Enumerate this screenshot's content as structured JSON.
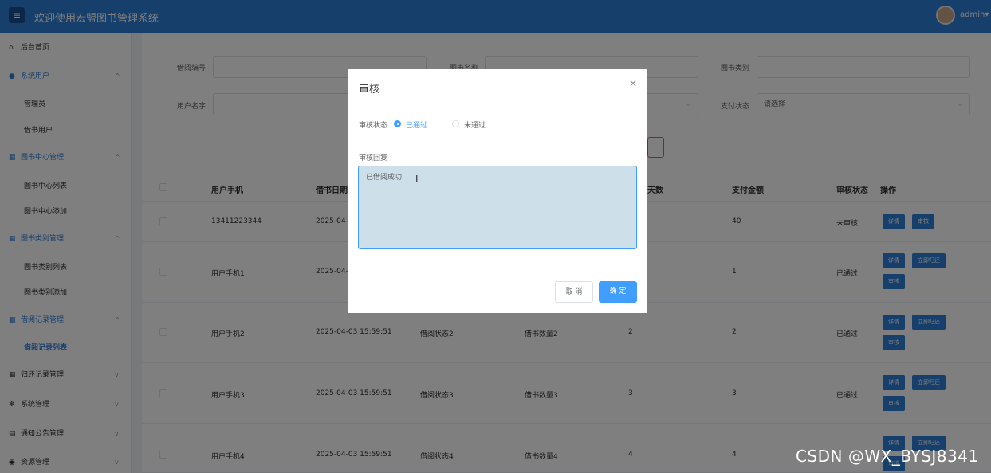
{
  "header": {
    "title": "欢迎使用宏盟图书管理系统",
    "user": "admin"
  },
  "sidebar": {
    "home": "后台首页",
    "system_users": "系统用户",
    "admin": "管理员",
    "borrow_users": "借书用户",
    "library_center_mgmt": "图书中心管理",
    "library_center_list": "图书中心列表",
    "library_center_add": "图书中心添加",
    "category_mgmt": "图书类别管理",
    "category_list": "图书类别列表",
    "category_add": "图书类别添加",
    "borrow_mgmt": "借阅记录管理",
    "borrow_list": "借阅记录列表",
    "return_mgmt": "归还记录管理",
    "system_mgmt": "系统管理",
    "notice_mgmt": "通知公告管理",
    "resource_mgmt": "资源管理"
  },
  "filters": {
    "borrow_no": "借阅编号",
    "book_name": "图书名称",
    "book_category": "图书类别",
    "user_name": "用户名字",
    "pay_status": "支付状态",
    "pay_placeholder": "请选择"
  },
  "table": {
    "headers": {
      "phone": "用户手机",
      "borrow_date": "借书日期",
      "days": "天数",
      "amount": "支付金额",
      "audit": "审核状态",
      "ops": "操作"
    },
    "rows": [
      {
        "phone": "13411223344",
        "date": "2025-04-",
        "status": "",
        "qty": "",
        "days": "",
        "amount": "40",
        "audit": "未审核"
      },
      {
        "phone": "用户手机1",
        "date": "2025-04-",
        "status": "",
        "qty": "",
        "days": "",
        "amount": "1",
        "audit": "已通过"
      },
      {
        "phone": "用户手机2",
        "date": "2025-04-03 15:59:51",
        "status": "借阅状态2",
        "qty": "借书数量2",
        "days": "2",
        "amount": "2",
        "audit": "已通过"
      },
      {
        "phone": "用户手机3",
        "date": "2025-04-03 15:59:51",
        "status": "借阅状态3",
        "qty": "借书数量3",
        "days": "3",
        "amount": "3",
        "audit": "已通过"
      },
      {
        "phone": "用户手机4",
        "date": "2025-04-03 15:59:51",
        "status": "借阅状态4",
        "qty": "借书数量4",
        "days": "4",
        "amount": "4",
        "audit": ""
      }
    ],
    "btn_detail": "详情",
    "btn_audit": "审核",
    "btn_return": "立即归还"
  },
  "modal": {
    "title": "审核",
    "status_label": "审核状态",
    "opt_pass": "已通过",
    "opt_fail": "未通过",
    "reply_label": "审核回复",
    "reply_value": "已借阅成功",
    "cancel": "取 消",
    "confirm": "确 定"
  },
  "watermark": "CSDN @WX_BYSJ8341",
  "colors": {
    "accent": "#2f7ed8",
    "primary": "#409eff"
  }
}
